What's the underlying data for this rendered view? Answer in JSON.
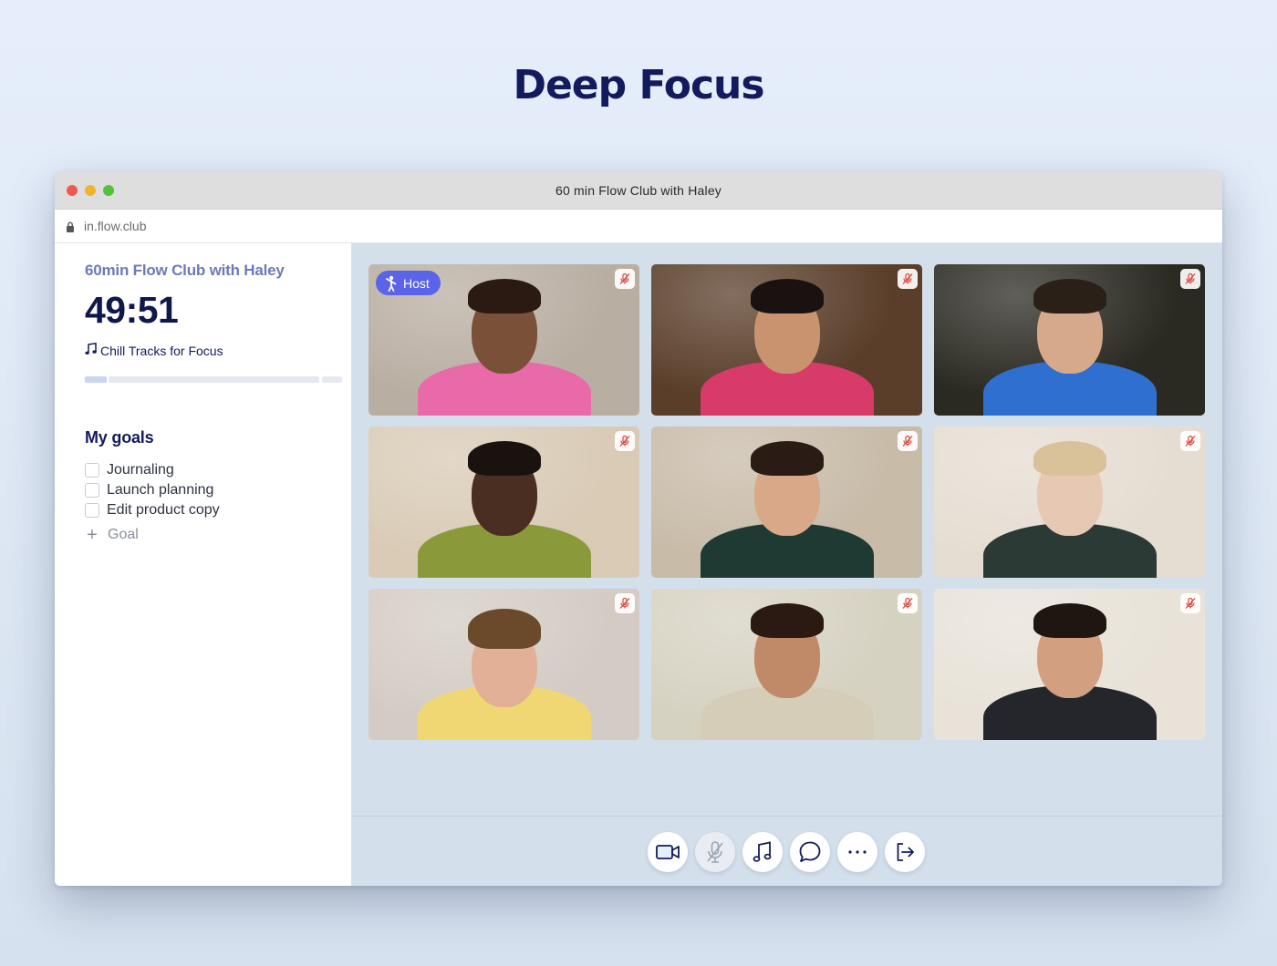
{
  "hero": {
    "title": "Deep Focus"
  },
  "window": {
    "title": "60 min Flow Club with Haley",
    "url": "in.flow.club"
  },
  "sidebar": {
    "session_title": "60min Flow Club with Haley",
    "timer": "49:51",
    "music_label": "Chill Tracks for Focus",
    "progress_fraction": 0.1,
    "goals_title": "My goals",
    "goals": [
      {
        "label": "Journaling",
        "checked": false
      },
      {
        "label": "Launch planning",
        "checked": false
      },
      {
        "label": "Edit product copy",
        "checked": false
      }
    ],
    "add_goal_label": "Goal"
  },
  "participants": [
    {
      "role": "host",
      "host_label": "Host",
      "muted": true,
      "bg": "#b9aea2",
      "skin": "#7a5038",
      "shirt": "#e86aa8",
      "hair": "#2a1a12"
    },
    {
      "muted": true,
      "bg": "#5a3e2a",
      "skin": "#c8936e",
      "shirt": "#d83a6a",
      "hair": "#1a1210"
    },
    {
      "muted": true,
      "bg": "#2b2a22",
      "skin": "#d6a98a",
      "shirt": "#2f6fd0",
      "hair": "#2a2018"
    },
    {
      "muted": true,
      "bg": "#d9cbb6",
      "skin": "#4a2e22",
      "shirt": "#8a9a3a",
      "hair": "#1a120e"
    },
    {
      "muted": true,
      "bg": "#c8bba8",
      "skin": "#d8a888",
      "shirt": "#1f3a33",
      "hair": "#2a1c14"
    },
    {
      "muted": true,
      "bg": "#e6ddd2",
      "skin": "#e7c8b2",
      "shirt": "#2c3a36",
      "hair": "#d9c29a"
    },
    {
      "muted": true,
      "bg": "#d4ccc4",
      "skin": "#e2b096",
      "shirt": "#f0d774",
      "hair": "#6a4a2a"
    },
    {
      "muted": true,
      "bg": "#d6d2c2",
      "skin": "#c08a68",
      "shirt": "#d6cdb8",
      "hair": "#2a1a12"
    },
    {
      "muted": true,
      "bg": "#e8e2d8",
      "skin": "#d2a080",
      "shirt": "#24262c",
      "hair": "#1e1610"
    }
  ],
  "controls": [
    {
      "icon": "video-camera-icon",
      "enabled": true
    },
    {
      "icon": "microphone-muted-icon",
      "enabled": false
    },
    {
      "icon": "music-note-icon",
      "enabled": true
    },
    {
      "icon": "chat-bubble-icon",
      "enabled": true
    },
    {
      "icon": "more-options-icon",
      "enabled": true
    },
    {
      "icon": "leave-icon",
      "enabled": true
    }
  ],
  "colors": {
    "accent": "#5b63e8",
    "navy": "#141b5c",
    "session_title": "#6d7ab8",
    "mute_red": "#d8453a"
  }
}
